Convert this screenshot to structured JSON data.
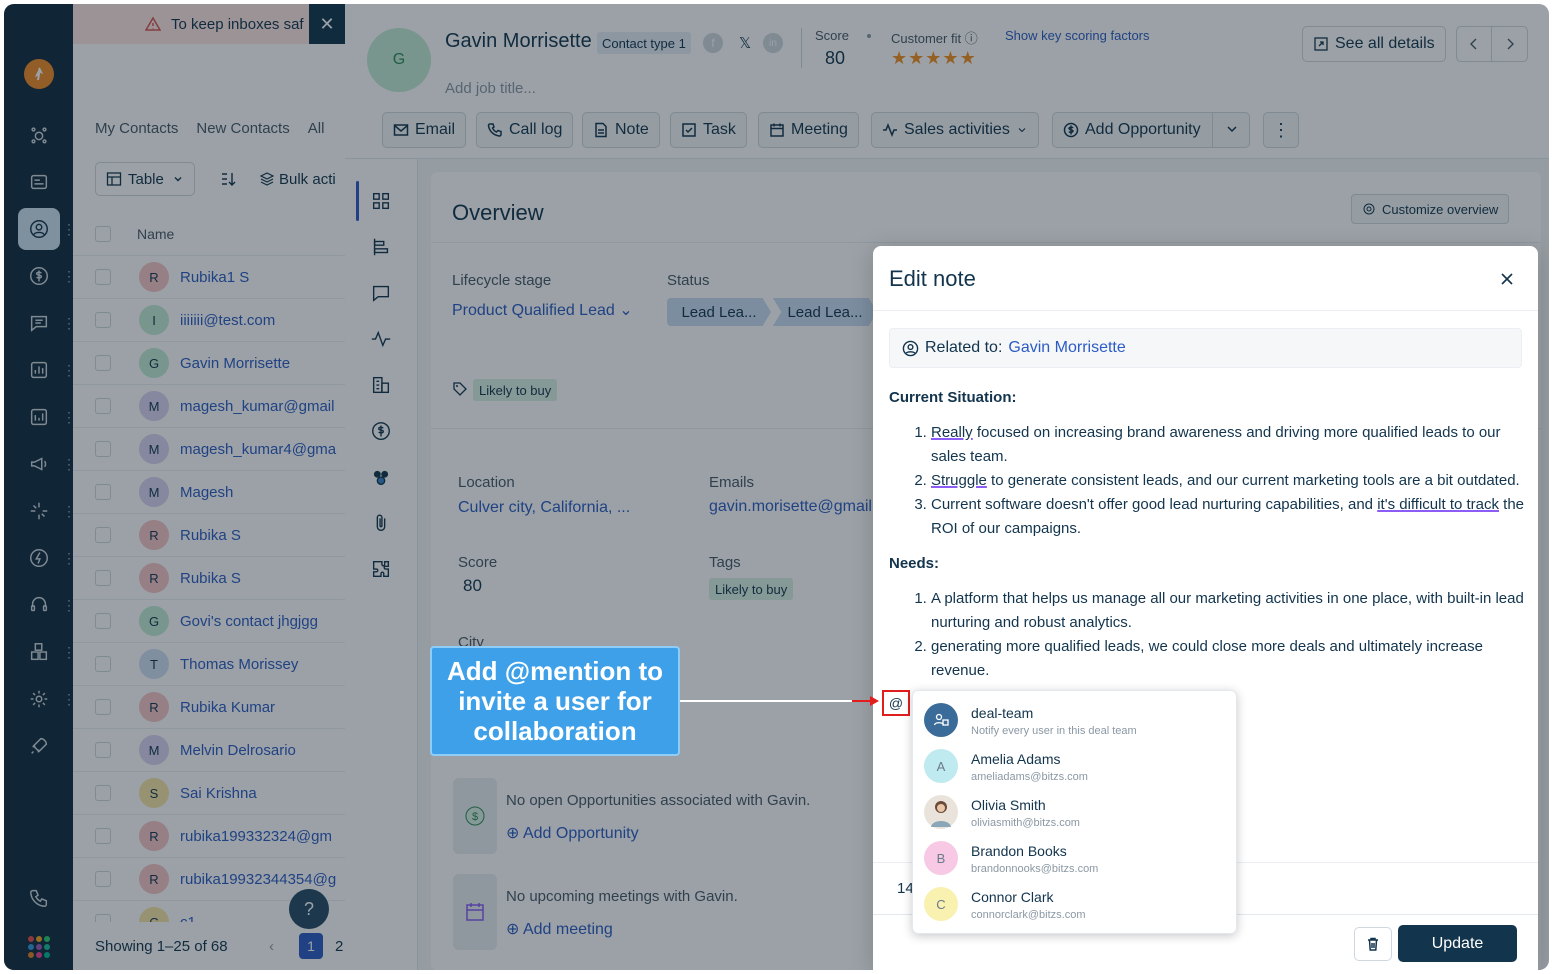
{
  "banner": {
    "text": "To keep inboxes saf",
    "close": "✕"
  },
  "list": {
    "tabs": [
      "My Contacts",
      "New Contacts",
      "All"
    ],
    "table_btn": "Table",
    "bulk_btn": "Bulk acti",
    "col_name": "Name",
    "rows": [
      {
        "name": "Rubika1 S",
        "initial": "R",
        "color": "#f6c4c7"
      },
      {
        "name": "iiiiiii@test.com",
        "initial": "I",
        "color": "#c3ecd4"
      },
      {
        "name": "Gavin Morrisette",
        "initial": "G",
        "color": "#c3ecd4"
      },
      {
        "name": "magesh_kumar@gmail",
        "initial": "M",
        "color": "#d9d4f2"
      },
      {
        "name": "magesh_kumar4@gma",
        "initial": "M",
        "color": "#d9d4f2"
      },
      {
        "name": "Magesh",
        "initial": "M",
        "color": "#d9d4f2"
      },
      {
        "name": "Rubika S",
        "initial": "R",
        "color": "#f6c4c7"
      },
      {
        "name": "Rubika S",
        "initial": "R",
        "color": "#f6c4c7"
      },
      {
        "name": "Govi's contact jhgjgg",
        "initial": "G",
        "color": "#c3ecd4"
      },
      {
        "name": "Thomas Morissey",
        "initial": "T",
        "color": "#cfe0f5"
      },
      {
        "name": "Rubika Kumar",
        "initial": "R",
        "color": "#f6c4c7"
      },
      {
        "name": "Melvin Delrosario",
        "initial": "M",
        "color": "#d9d4f2"
      },
      {
        "name": "Sai Krishna",
        "initial": "S",
        "color": "#f8e7a6"
      },
      {
        "name": "rubika199332324@gm",
        "initial": "R",
        "color": "#f6c4c7"
      },
      {
        "name": "rubika19932344354@g",
        "initial": "R",
        "color": "#f6c4c7"
      },
      {
        "name": "c1",
        "initial": "C",
        "color": "#f8e7a6"
      }
    ],
    "footer": "Showing 1–25 of 68",
    "page_current": "1",
    "page_next": "2",
    "help": "?"
  },
  "contact": {
    "avatar_initial": "G",
    "name": "Gavin Morrisette",
    "type_badge": "Contact type 1",
    "job_placeholder": "Add job title...",
    "score_label": "Score",
    "score_value": "80",
    "fit_label": "Customer fit",
    "fit_stars": 5,
    "scoring_link": "Show key scoring factors",
    "see_all": "See all details"
  },
  "actions": {
    "email": "Email",
    "call_log": "Call log",
    "note": "Note",
    "task": "Task",
    "meeting": "Meeting",
    "sales_activities": "Sales activities",
    "add_opportunity": "Add Opportunity"
  },
  "overview": {
    "title": "Overview",
    "customize": "Customize overview",
    "lifecycle_label": "Lifecycle stage",
    "lifecycle_value": "Product Qualified Lead",
    "status_label": "Status",
    "status_steps": [
      "Lead Lea...",
      "Lead Lea..."
    ],
    "tag_top": "Likely to buy",
    "location_label": "Location",
    "location_value": "Culver city, California, ...",
    "emails_label": "Emails",
    "emails_value": "gavin.morisette@gmail",
    "score_label": "Score",
    "score_value": "80",
    "tags_label": "Tags",
    "tags_value": "Likely to buy",
    "city_label": "City",
    "opp_text": "No open Opportunities associated with Gavin.",
    "opp_link": "Add Opportunity",
    "meet_text": "No upcoming meetings with Gavin.",
    "meet_link": "Add meeting"
  },
  "modal": {
    "title": "Edit note",
    "related_label": "Related to:",
    "related_value": "Gavin Morrisette",
    "situation_heading": "Current Situation:",
    "s1_a": "Really",
    "s1_b": " focused on increasing brand awareness and driving more qualified leads to our sales team.",
    "s2_a": "Struggle",
    "s2_b": " to generate consistent leads, and our current marketing tools are a bit outdated.",
    "s3_a": "Current software doesn't offer good lead nurturing capabilities, and ",
    "s3_b": "it's difficult to track",
    "s3_c": " the ROI of our campaigns.",
    "needs_heading": "Needs:",
    "n1": "A platform that helps us manage all our marketing activities in one place, with built-in lead nurturing and robust analytics.",
    "n2": "generating more qualified leads, we could close more deals and ultimately increase revenue.",
    "at_symbol": "@",
    "partial_text": "14",
    "update": "Update"
  },
  "mention": [
    {
      "name": "deal-team",
      "sub": "Notify every user in this deal team",
      "initial": "",
      "color": "#3b6c99"
    },
    {
      "name": "Amelia Adams",
      "sub": "ameliadams@bitzs.com",
      "initial": "A",
      "color": "#bfeaf0"
    },
    {
      "name": "Olivia Smith",
      "sub": "oliviasmith@bitzs.com",
      "initial": "",
      "color": "#e9e3dc"
    },
    {
      "name": "Brandon Books",
      "sub": "brandonnooks@bitzs.com",
      "initial": "B",
      "color": "#f7c9e4"
    },
    {
      "name": "Connor Clark",
      "sub": "connorclark@bitzs.com",
      "initial": "C",
      "color": "#f9f1b0"
    }
  ],
  "callout": "Add @mention to invite a user for collaboration"
}
